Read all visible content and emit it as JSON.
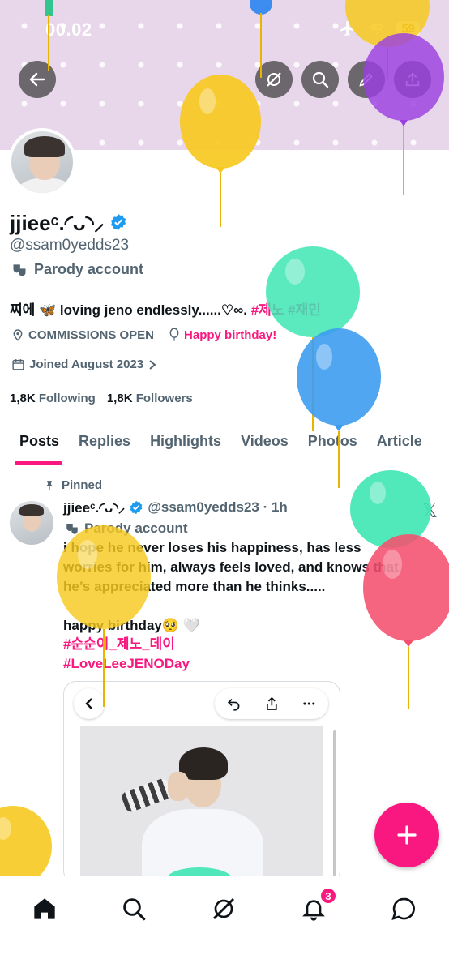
{
  "status": {
    "time": "00.02",
    "battery": "59"
  },
  "profile": {
    "display_name": "jjieeᶜ.◜ᴗ◝⸝",
    "handle": "@ssam0yedds23",
    "parody_label": "Parody account",
    "bio_text": "찌에 🦋 loving jeno endlessly......♡∞. ",
    "bio_tags": "#제노 #재민",
    "commissions": "COMMISSIONS OPEN",
    "birthday": "Happy birthday!",
    "joined": "Joined August 2023",
    "following_count": "1,8K",
    "following_label": "Following",
    "followers_count": "1,8K",
    "followers_label": "Followers"
  },
  "tabs": [
    "Posts",
    "Replies",
    "Highlights",
    "Videos",
    "Photos",
    "Article"
  ],
  "post": {
    "pinned_label": "Pinned",
    "name": "jjieeᶜ.◜ᴗ◝⸝",
    "meta": "@ssam0yedds23 · 1h",
    "parody_label": "Parody account",
    "text": "i hope he never loses his happiness, has less worries for him, always feels loved, and knows that he’s appreciated more than he thinks.....",
    "text2": "happy birthday🥺 🤍",
    "tag1": "#순순이_제노_데이",
    "tag2": "#LoveLeeJENODay"
  },
  "nav": {
    "notification_count": "3"
  },
  "colors": {
    "accent": "#f91880",
    "verified": "#1d9bf0",
    "muted": "#536471"
  }
}
